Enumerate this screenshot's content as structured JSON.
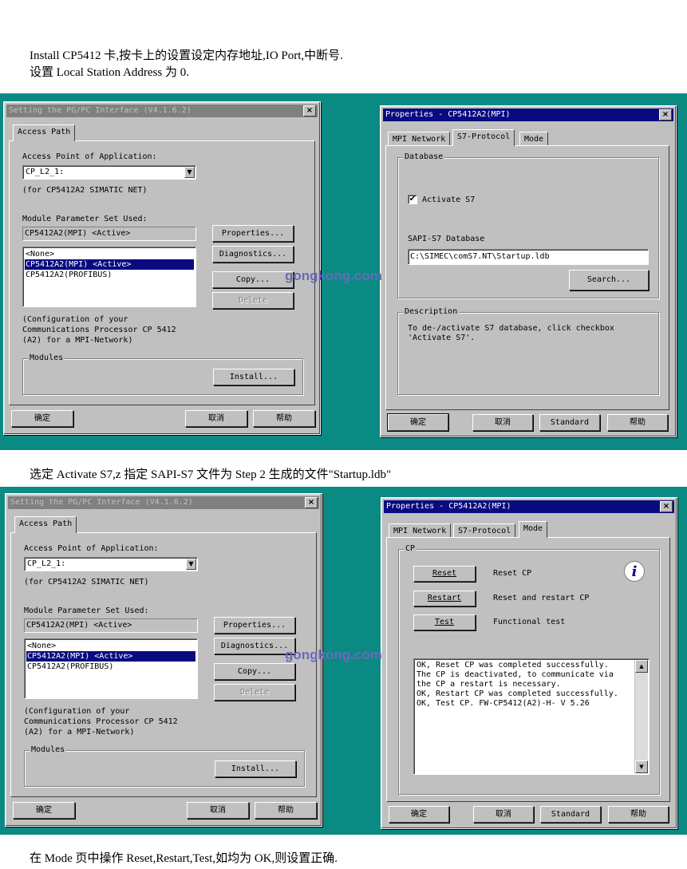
{
  "doc": {
    "intro_line1": "Install CP5412 卡,按卡上的设置设定内存地址,IO Port,中断号.",
    "intro_line2": "设置 Local Station Address 为 0.",
    "caption_middle": "选定 Activate S7,z 指定 SAPI-S7 文件为 Step 2 生成的文件\"Startup.ldb\"",
    "caption_bottom": "在 Mode 页中操作 Reset,Restart,Test,如均为 OK,则设置正确."
  },
  "colors": {
    "band": "#0b8a84",
    "titlebar_active": "#0a0a80",
    "titlebar_inactive": "#808080",
    "watermark": "#6a6ab8"
  },
  "watermark": "gongkong.com",
  "pgpc": {
    "title": "Setting the PG/PC Interface (V4.1.6.2)",
    "tab": "Access Path",
    "access_point_label": "Access Point of Application:",
    "access_point_value": "CP_L2_1:",
    "for_note": "(for CP5412A2   SIMATIC NET)",
    "module_param_label": "Module Parameter Set Used:",
    "module_param_value": "CP5412A2(MPI)   <Active>",
    "list_items": [
      "<None>",
      "CP5412A2(MPI)   <Active>",
      "CP5412A2(PROFIBUS)"
    ],
    "config_note": [
      "(Configuration of your",
      "Communications Processor CP 5412",
      "(A2) for a MPI-Network)"
    ],
    "modules_group": "Modules",
    "btn_properties": "Properties...",
    "btn_diagnostics": "Diagnostics...",
    "btn_copy": "Copy...",
    "btn_delete": "Delete",
    "btn_install": "Install...",
    "btn_ok": "确定",
    "btn_cancel": "取消",
    "btn_help": "帮助"
  },
  "props": {
    "title": "Properties - CP5412A2(MPI)",
    "tabs": [
      "MPI Network",
      "S7-Protocol",
      "Mode"
    ],
    "database_group": "Database",
    "activate_label": "Activate S7",
    "activate_check": "✔",
    "sapi_label": "SAPI-S7 Database",
    "sapi_value": "C:\\SIMEC\\comS7.NT\\Startup.ldb",
    "btn_search": "Search...",
    "description_group": "Description",
    "description_text": [
      "To de-/activate S7 database, click checkbox",
      "'Activate S7'."
    ],
    "cp_group": "CP",
    "btn_reset": "Reset",
    "btn_restart": "Restart",
    "btn_test": "Test",
    "reset_desc": "Reset CP",
    "restart_desc": "Reset and restart CP",
    "test_desc": "Functional test",
    "info_icon": "i",
    "messages": [
      "OK, Reset CP was completed successfully.",
      "The CP is deactivated, to communicate via",
      "the CP a restart is necessary.",
      "OK, Restart CP was completed successfully.",
      "OK, Test CP. FW-CP5412(A2)-H- V 5.26"
    ],
    "btn_ok": "确定",
    "btn_cancel": "取消",
    "btn_standard": "Standard",
    "btn_help": "帮助"
  }
}
